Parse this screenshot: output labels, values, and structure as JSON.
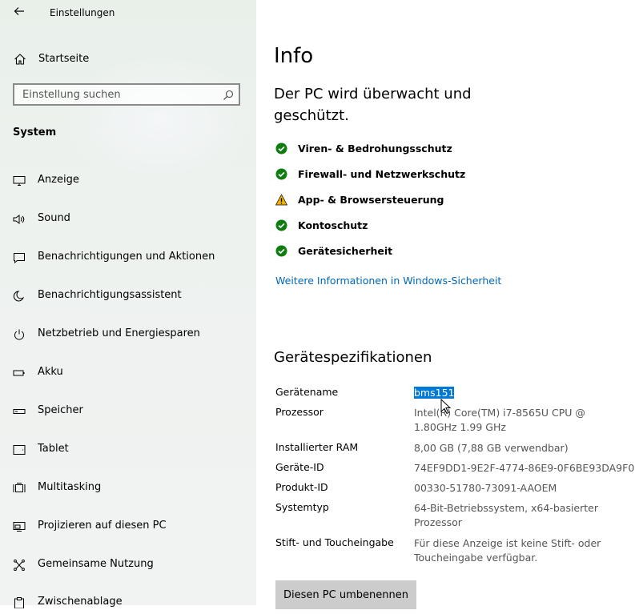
{
  "app": {
    "title": "Einstellungen"
  },
  "sidebar": {
    "home_label": "Startseite",
    "search_placeholder": "Einstellung suchen",
    "section": "System",
    "items": [
      {
        "label": "Anzeige",
        "icon": "monitor-icon"
      },
      {
        "label": "Sound",
        "icon": "speaker-icon"
      },
      {
        "label": "Benachrichtigungen und Aktionen",
        "icon": "notification-icon"
      },
      {
        "label": "Benachrichtigungsassistent",
        "icon": "moon-icon"
      },
      {
        "label": "Netzbetrieb und Energiesparen",
        "icon": "power-icon"
      },
      {
        "label": "Akku",
        "icon": "battery-icon"
      },
      {
        "label": "Speicher",
        "icon": "storage-icon"
      },
      {
        "label": "Tablet",
        "icon": "tablet-icon"
      },
      {
        "label": "Multitasking",
        "icon": "multitasking-icon"
      },
      {
        "label": "Projizieren auf diesen PC",
        "icon": "project-icon"
      },
      {
        "label": "Gemeinsame Nutzung",
        "icon": "share-icon"
      },
      {
        "label": "Zwischenablage",
        "icon": "clipboard-icon"
      }
    ]
  },
  "main": {
    "title": "Info",
    "protection_heading": "Der PC wird überwacht und geschützt.",
    "status_items": [
      {
        "label": "Viren- & Bedrohungsschutz",
        "state": "ok"
      },
      {
        "label": "Firewall- und Netzwerkschutz",
        "state": "ok"
      },
      {
        "label": "App- & Browsersteuerung",
        "state": "warning"
      },
      {
        "label": "Kontoschutz",
        "state": "ok"
      },
      {
        "label": "Gerätesicherheit",
        "state": "ok"
      }
    ],
    "security_link": "Weitere Informationen in Windows-Sicherheit",
    "specs_heading": "Gerätespezifikationen",
    "specs": [
      {
        "key": "Gerätename",
        "value": "bms151"
      },
      {
        "key": "Prozessor",
        "value": "Intel(R) Core(TM) i7-8565U CPU @ 1.80GHz 1.99 GHz"
      },
      {
        "key": "Installierter RAM",
        "value": "8,00 GB (7,88 GB verwendbar)"
      },
      {
        "key": "Geräte-ID",
        "value": "74EF9DD1-9E2F-4774-86E9-0F6BE93DA9F0"
      },
      {
        "key": "Produkt-ID",
        "value": "00330-51780-73091-AAOEM"
      },
      {
        "key": "Systemtyp",
        "value": "64-Bit-Betriebssystem, x64-basierter Prozessor"
      },
      {
        "key": "Stift- und Toucheingabe",
        "value": "Für diese Anzeige ist keine Stift- oder Toucheingabe verfügbar."
      }
    ],
    "rename_button": "Diesen PC umbenennen"
  },
  "colors": {
    "ok": "#107c10",
    "warning": "#f0b400",
    "link": "#0067b8",
    "selection": "#0078d7"
  }
}
